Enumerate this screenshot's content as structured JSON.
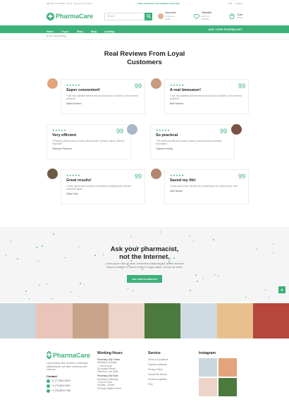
{
  "topbar": {
    "phone": "888 345 78 798799",
    "links": [
      "About",
      "Service Information"
    ],
    "promo": "FREE SHIPPING FOR ORDERS OVER $39",
    "right": [
      "USD",
      "English"
    ]
  },
  "header": {
    "logo": "PharmaCare",
    "search_placeholder": "Search",
    "account_title": "Account",
    "account_sub": "Dr. Emma Rollin",
    "wishlist_title": "Wishlist",
    "wishlist_sub": "Edit Your Wishlist",
    "cart_title": "Cart",
    "cart_sub": "$0.00",
    "cart_count": "0"
  },
  "nav": {
    "items": [
      "Home",
      "Pages",
      "Shop",
      "Blog",
      "Landing"
    ],
    "active": "Pages",
    "ask": "ASK YOUR PHARMACIST"
  },
  "breadcrumb": "Home / Review Page",
  "reviews": {
    "title_line1": "Real Reviews From Loyal",
    "title_line2": "Customers",
    "stars": "★★★★★",
    "quote": "99",
    "items": [
      {
        "title": "Super convenient!",
        "text": "\"I am very satisfied with the service and speed of delivery of the ordered products.\"",
        "author": "Martha Hudson",
        "avatar_color": "#e2a47b"
      },
      {
        "title": "A real timesaver!",
        "text": "\"I am very satisfied with the service and speed of delivery of the ordered products.\"",
        "author": "Beth Sanders",
        "avatar_color": "#c89a7e"
      },
      {
        "title": "Very efficient",
        "text": "\"Phasellus viverra nulla ut metus varius laoreet. Quisque rutrum. Aenean imperdiet.\"",
        "author": "Silvia Ann Peterson",
        "avatar_color": "#a8b8c9"
      },
      {
        "title": "So practical",
        "text": "\"The staff is friendly and always ready to provide all the necessary information.\"",
        "author": "Fayanne Holmby",
        "avatar_color": "#7a5244"
      },
      {
        "title": "Great results!",
        "text": "\"Lorem ipsum dolor sit amet, consectetuer adipiscing elit. Aenean commodo ligula.\"",
        "author": "Gillian Tolat",
        "avatar_color": "#6f5a45"
      },
      {
        "title": "Saved my life!",
        "text": "\"Lorem ipsum felis, ultricies nec, pellentesque eu, pretium quis, sem.\"",
        "author": "Alice Nuezal",
        "avatar_color": "#b08870"
      }
    ]
  },
  "ask": {
    "title_line1": "Ask your pharmacist,",
    "title_line2": "not the Internet.",
    "text_line1": "Lorem ipsum dolor sit amet, consectetur adipiscing elit, sed do eiusmod",
    "text_line2": "tempor incididunt ut labore et dolore magna aliqua. Ut enim ad minim",
    "button": "ASK YOUR PHARMACIST"
  },
  "gallery": {
    "colors": [
      "#c9d7df",
      "#e9c4b8",
      "#c7a48a",
      "#ecd4c8",
      "#4c7a3d",
      "#cfdbe2",
      "#e9c08d",
      "#b7463b"
    ]
  },
  "footer": {
    "logo": "PharmaCare",
    "about": "Lorem ipsum dolor sit amet, consectetur adipiscing elit, sed diam nonummy nibh euismod.",
    "contact_title": "Contact",
    "contacts": [
      "+1 (77) 8004 5674",
      "+1 (77) 8004 4521",
      "+1 (78) 8004 1788"
    ],
    "hours_title": "Working Hours",
    "hours": [
      "Pharmacy City Center",
      "Monday to Sunday",
      "- 7 am to 8 pm",
      "28 Hudson Street",
      "Villa Ruiz, Gra 3408",
      "Pharmacy Old Town",
      "Monday to Saturday",
      "- 8 am to 9 pm",
      "Sunday - Closed",
      "18 Royal Walker Street"
    ],
    "service_title": "Service",
    "services": [
      "Terms & Conditions",
      "Payment methods",
      "Privacy Policy",
      "Cancel the service",
      "Product complaint",
      "FAQ"
    ],
    "instagram_title": "Instagram"
  }
}
